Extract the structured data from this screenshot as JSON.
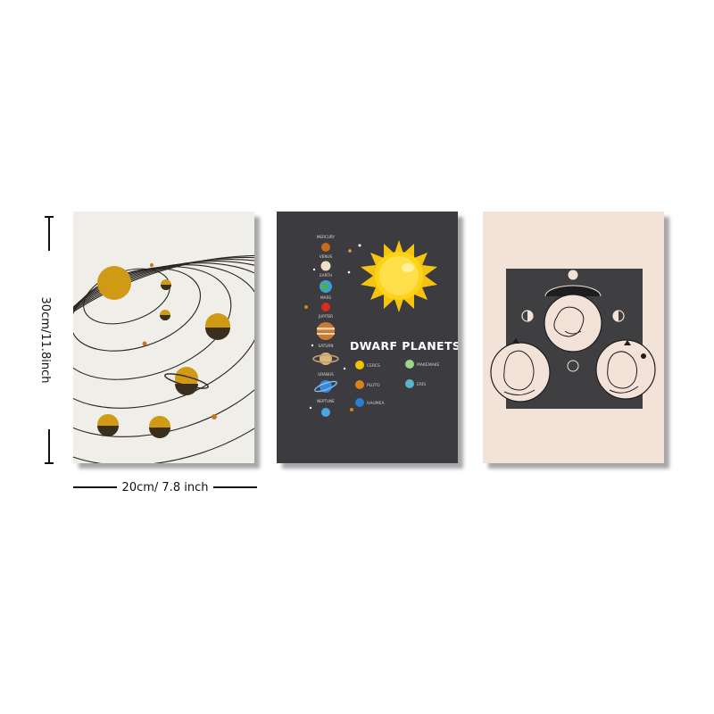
{
  "dimensions": {
    "height_label": "30cm/11.8inch",
    "width_label": "20cm/ 7.8 inch"
  },
  "posters": [
    {
      "name": "solar-system-orbits",
      "background": "#efeee8",
      "accent": "#d19a14"
    },
    {
      "name": "dwarf-planets",
      "background": "#3c3c40",
      "title": "DWARF PLANETS",
      "planets": [
        "MERCURY",
        "VENUS",
        "EARTH",
        "MARS",
        "JUPITER",
        "SATURN",
        "URANUS",
        "NEPTUNE"
      ],
      "dwarf_planets": [
        "CERES",
        "PLUTO",
        "HAUMEA",
        "MAKEMAKE",
        "ERIS"
      ]
    },
    {
      "name": "moon-phases-figures",
      "background": "#f3e2d7",
      "panel": "#3f3f41"
    }
  ],
  "colors": {
    "sun": "#ffd21a",
    "ceres": "#f5c400",
    "pluto": "#d9841a",
    "haumea": "#2a7fd4",
    "makemake": "#9cd68a",
    "eris": "#5ab5c8"
  }
}
